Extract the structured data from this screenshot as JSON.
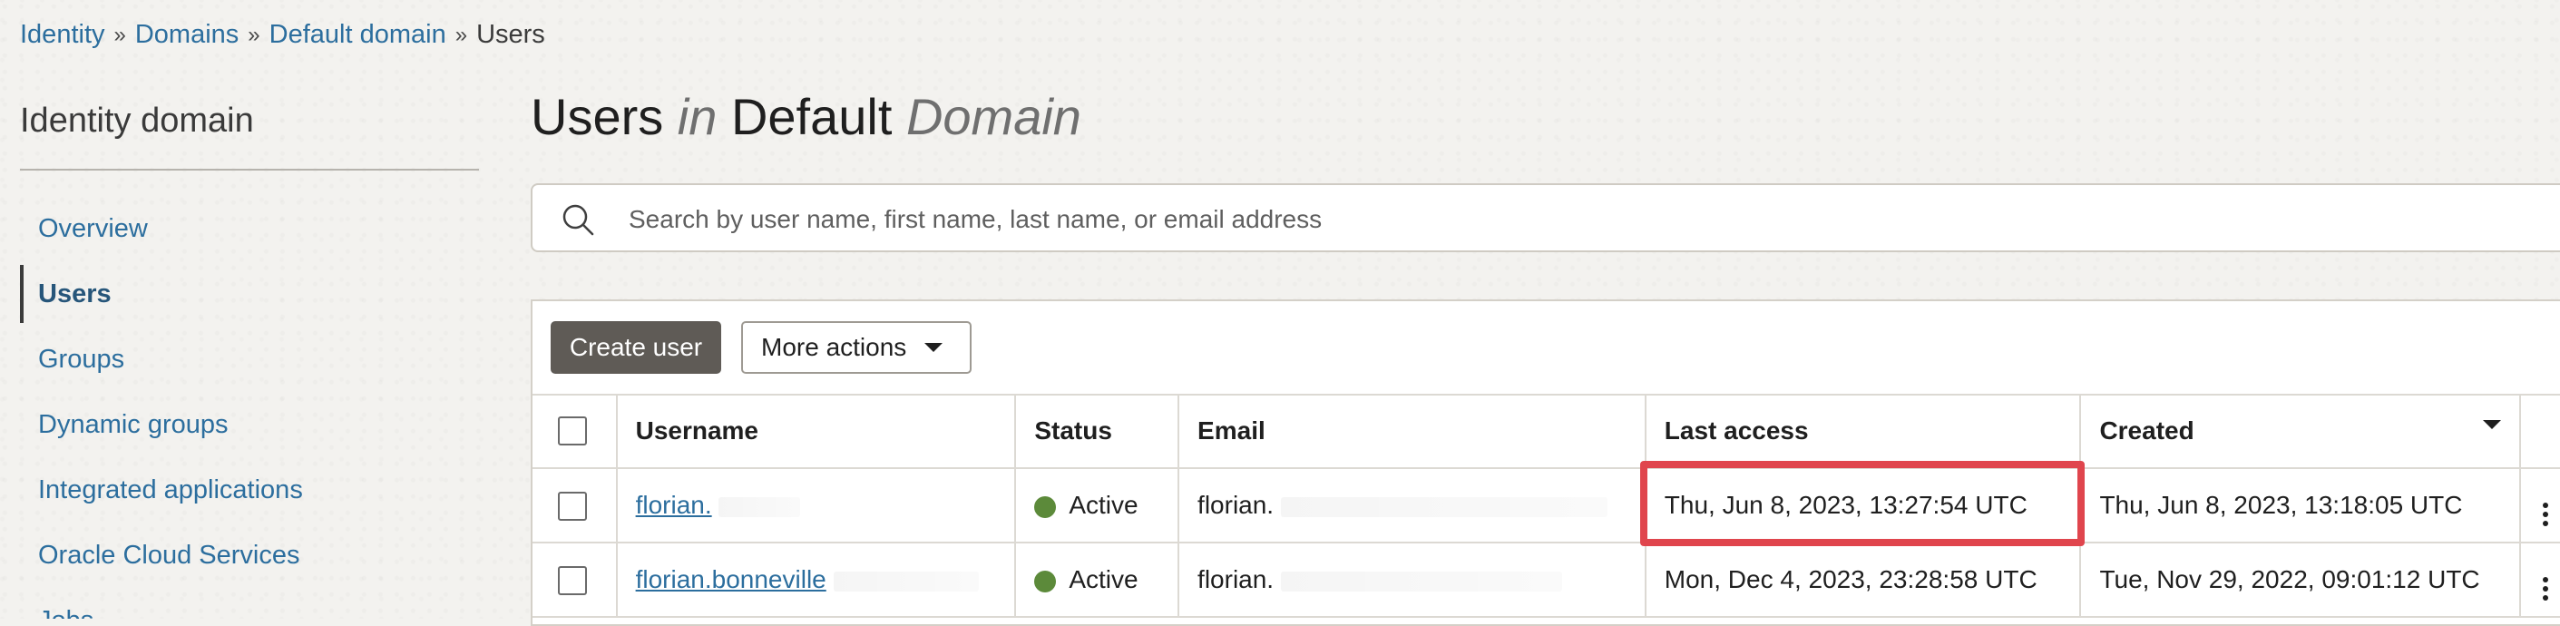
{
  "breadcrumb": [
    "Identity",
    "Domains",
    "Default domain",
    "Users"
  ],
  "breadcrumb_separator": "»",
  "sidebar": {
    "title": "Identity domain",
    "items": [
      {
        "label": "Overview"
      },
      {
        "label": "Users"
      },
      {
        "label": "Groups"
      },
      {
        "label": "Dynamic groups"
      },
      {
        "label": "Integrated applications"
      },
      {
        "label": "Oracle Cloud Services"
      },
      {
        "label": "Jobs"
      }
    ],
    "active_item": "Users"
  },
  "page_title": {
    "part1": "Users",
    "part2": "in",
    "part3": "Default",
    "part4": "Domain"
  },
  "search": {
    "placeholder": "Search by user name, first name, last name, or email address",
    "value": "",
    "icon": "search-icon"
  },
  "toolbar": {
    "create_label": "Create user",
    "more_label": "More actions"
  },
  "table": {
    "columns": [
      "Username",
      "Status",
      "Email",
      "Last access",
      "Created"
    ],
    "rows": [
      {
        "username": "florian.",
        "status": "Active",
        "email": "florian.",
        "last_access": "Thu, Jun 8, 2023, 13:27:54 UTC",
        "created": "Thu, Jun 8, 2023, 13:18:05 UTC"
      },
      {
        "username": "florian.bonneville",
        "status": "Active",
        "email": "florian.",
        "last_access": "Mon, Dec 4, 2023, 23:28:58 UTC",
        "created": "Tue, Nov 29, 2022, 09:01:12 UTC"
      }
    ]
  },
  "colors": {
    "link": "#2c6e9e",
    "active_status": "#5c8a3a",
    "highlight": "#e0454d",
    "primary_button": "#5f5b56"
  }
}
